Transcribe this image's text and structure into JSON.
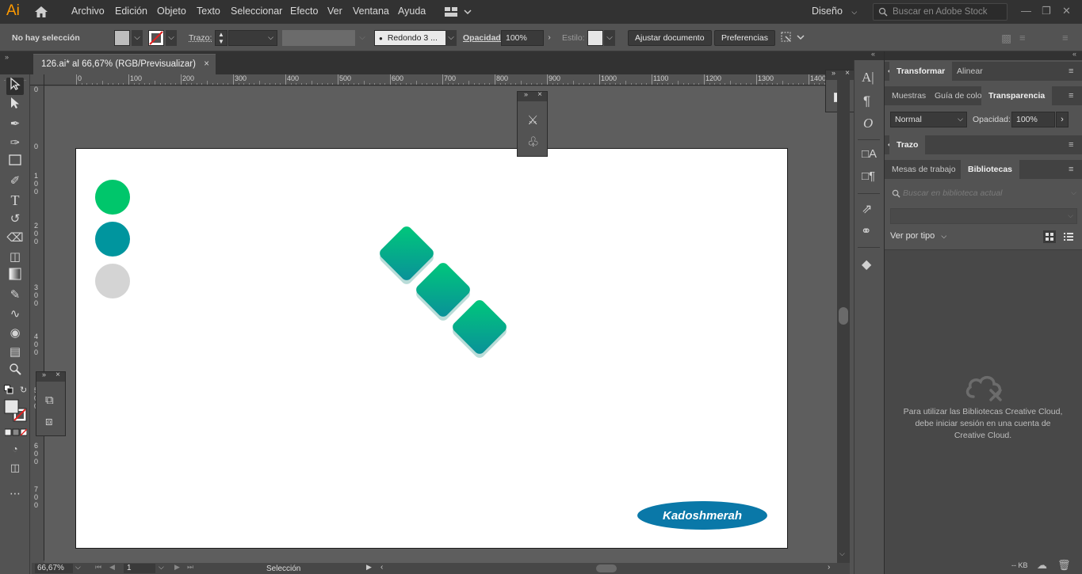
{
  "app": {
    "logo": "Ai",
    "workspace": "Diseño",
    "stock_placeholder": "Buscar en Adobe Stock"
  },
  "menu": [
    "Archivo",
    "Edición",
    "Objeto",
    "Texto",
    "Seleccionar",
    "Efecto",
    "Ver",
    "Ventana",
    "Ayuda"
  ],
  "control": {
    "selection": "No hay selección",
    "stroke_label": "Trazo:",
    "brush_value": "Redondo 3 ...",
    "opacity_label": "Opacidad:",
    "opacity_value": "100%",
    "style_label": "Estilo:",
    "fit_button": "Ajustar documento",
    "prefs_button": "Preferencias"
  },
  "document_tab": {
    "title": "126.ai* al 66,67% (RGB/Previsualizar)",
    "close": "×"
  },
  "ruler_top": [
    "0",
    "100",
    "200",
    "300",
    "400",
    "500",
    "600",
    "700",
    "800",
    "900",
    "1000",
    "1100",
    "1200",
    "1300",
    "1400"
  ],
  "ruler_left": [
    "0",
    "0",
    "1 0 0",
    "2 0 0",
    "3 0 0",
    "4 0 0",
    "5 0 0",
    "6 0 0",
    "7 0 0"
  ],
  "artwork": {
    "circles": [
      "#00c66b",
      "#00959e",
      "#d4d4d4"
    ],
    "gradient_start": "#00c97a",
    "gradient_end": "#0a8f9a",
    "shadow": "#b9dcd8",
    "logo_text": "Kadoshmerah",
    "logo_color": "#0a78a8"
  },
  "panels": {
    "tabs_top": [
      "Transformar",
      "Alinear"
    ],
    "tabs_mid": [
      "Muestras",
      "Guía de colo",
      "Transparencia"
    ],
    "blend_mode": "Normal",
    "opacity_label": "Opacidad:",
    "opacity_value": "100%",
    "stroke_panel": "Trazo",
    "tabs_lib": [
      "Mesas de trabajo",
      "Bibliotecas"
    ],
    "lib_search_placeholder": "Buscar en biblioteca actual",
    "view_by": "Ver por tipo",
    "lib_message": "Para utilizar las Bibliotecas Creative Cloud, debe iniciar sesión en una cuenta de Creative Cloud."
  },
  "status": {
    "zoom": "66,67%",
    "page": "1",
    "tool": "Selección",
    "filesize": "-- KB"
  }
}
